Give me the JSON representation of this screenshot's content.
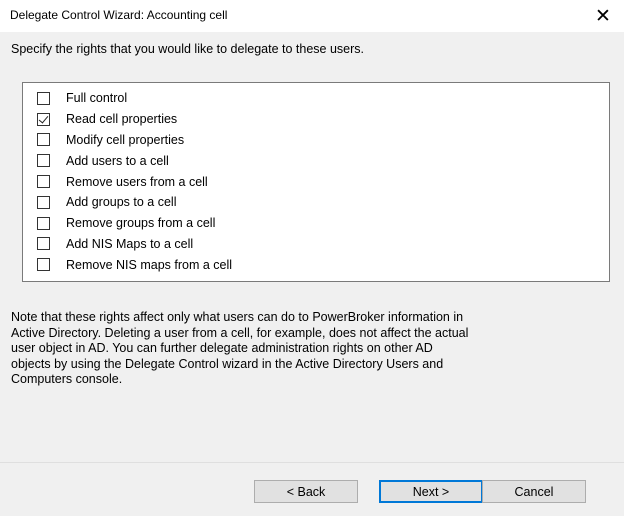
{
  "window": {
    "title": "Delegate Control Wizard: Accounting cell",
    "close_glyph": "✕"
  },
  "instruction": "Specify the rights that you would like to delegate to these users.",
  "rights": [
    {
      "label": "Full control",
      "checked": false
    },
    {
      "label": "Read cell properties",
      "checked": true
    },
    {
      "label": "Modify cell properties",
      "checked": false
    },
    {
      "label": "Add users to a cell",
      "checked": false
    },
    {
      "label": "Remove users from a cell",
      "checked": false
    },
    {
      "label": "Add groups to a cell",
      "checked": false
    },
    {
      "label": "Remove groups from a cell",
      "checked": false
    },
    {
      "label": "Add NIS Maps to a cell",
      "checked": false
    },
    {
      "label": "Remove NIS maps from a cell",
      "checked": false
    }
  ],
  "note_lines": [
    "Note that these rights affect only what users can do to PowerBroker information in",
    "Active Directory. Deleting a user from a cell, for example, does not affect the actual",
    "user object in AD. You can further delegate administration rights on other AD",
    "objects by using the Delegate Control wizard in the Active Directory Users and",
    "Computers console."
  ],
  "buttons": {
    "back": "< Back",
    "next": "Next >",
    "cancel": "Cancel"
  },
  "colors": {
    "default_button_border": "#0078d7",
    "dialog_background": "#f0f0f0"
  }
}
